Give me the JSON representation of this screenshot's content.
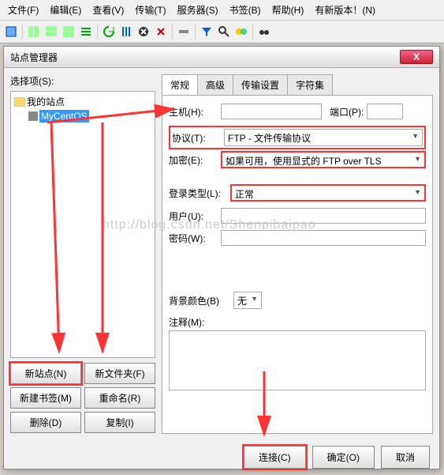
{
  "menubar": {
    "items": [
      "文件(F)",
      "编辑(E)",
      "查看(V)",
      "传输(T)",
      "服务器(S)",
      "书签(B)",
      "帮助(H)",
      "有新版本！(N)"
    ]
  },
  "dialog": {
    "title": "站点管理器",
    "close": "X"
  },
  "tree": {
    "label": "选择项(S):",
    "root": "我的站点",
    "site": "MyCentOS"
  },
  "buttons": {
    "newsite": "新站点(N)",
    "newfolder": "新文件夹(F)",
    "newbookmark": "新建书签(M)",
    "rename": "重命名(R)",
    "delete": "删除(D)",
    "copy": "复制(I)"
  },
  "tabs": {
    "general": "常规",
    "advanced": "高级",
    "transfer": "传输设置",
    "charset": "字符集"
  },
  "form": {
    "host_label": "主机(H):",
    "host_value": "",
    "port_label": "端口(P):",
    "port_value": "",
    "protocol_label": "协议(T):",
    "protocol_value": "FTP - 文件传输协议",
    "encryption_label": "加密(E):",
    "encryption_value": "如果可用，使用显式的 FTP over TLS",
    "logontype_label": "登录类型(L):",
    "logontype_value": "正常",
    "user_label": "用户(U):",
    "user_value": "",
    "password_label": "密码(W):",
    "password_value": "",
    "bgcolor_label": "背景颜色(B)",
    "bgcolor_value": "无",
    "comment_label": "注释(M):"
  },
  "footer": {
    "connect": "连接(C)",
    "ok": "确定(O)",
    "cancel": "取消"
  },
  "watermark": "http://blog.csdn.net/Shenpibaipao"
}
